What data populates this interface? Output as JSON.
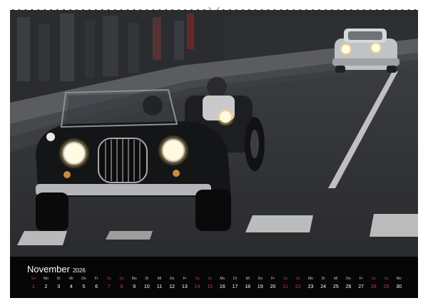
{
  "calendar": {
    "month": "November",
    "year": "2026",
    "days": [
      {
        "wd": "So",
        "d": "1",
        "type": "sun"
      },
      {
        "wd": "Mo",
        "d": "2",
        "type": "wk"
      },
      {
        "wd": "Di",
        "d": "3",
        "type": "wk"
      },
      {
        "wd": "Mi",
        "d": "4",
        "type": "wk"
      },
      {
        "wd": "Do",
        "d": "5",
        "type": "wk"
      },
      {
        "wd": "Fr",
        "d": "6",
        "type": "wk"
      },
      {
        "wd": "Sa",
        "d": "7",
        "type": "sat"
      },
      {
        "wd": "So",
        "d": "8",
        "type": "sun"
      },
      {
        "wd": "Mo",
        "d": "9",
        "type": "wk"
      },
      {
        "wd": "Di",
        "d": "10",
        "type": "wk"
      },
      {
        "wd": "Mi",
        "d": "11",
        "type": "wk"
      },
      {
        "wd": "Do",
        "d": "12",
        "type": "wk"
      },
      {
        "wd": "Fr",
        "d": "13",
        "type": "wk"
      },
      {
        "wd": "Sa",
        "d": "14",
        "type": "sat"
      },
      {
        "wd": "So",
        "d": "15",
        "type": "sun"
      },
      {
        "wd": "Mo",
        "d": "16",
        "type": "wk"
      },
      {
        "wd": "Di",
        "d": "17",
        "type": "wk"
      },
      {
        "wd": "Mi",
        "d": "18",
        "type": "wk"
      },
      {
        "wd": "Do",
        "d": "19",
        "type": "wk"
      },
      {
        "wd": "Fr",
        "d": "20",
        "type": "wk"
      },
      {
        "wd": "Sa",
        "d": "21",
        "type": "sat"
      },
      {
        "wd": "So",
        "d": "22",
        "type": "sun"
      },
      {
        "wd": "Mo",
        "d": "23",
        "type": "wk"
      },
      {
        "wd": "Di",
        "d": "24",
        "type": "wk"
      },
      {
        "wd": "Mi",
        "d": "25",
        "type": "wk"
      },
      {
        "wd": "Do",
        "d": "26",
        "type": "wk"
      },
      {
        "wd": "Fr",
        "d": "27",
        "type": "wk"
      },
      {
        "wd": "Sa",
        "d": "28",
        "type": "sat"
      },
      {
        "wd": "So",
        "d": "29",
        "type": "sun"
      },
      {
        "wd": "Mo",
        "d": "30",
        "type": "wk"
      }
    ]
  },
  "colors": {
    "weekend": "#d2383b",
    "calendar_bg": "#060606"
  }
}
